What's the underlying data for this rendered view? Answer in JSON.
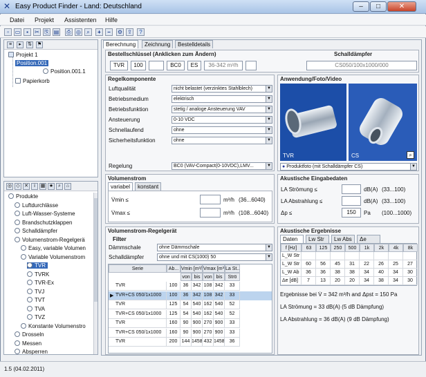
{
  "window": {
    "title": "Easy Product Finder - Land: Deutschland",
    "minimize": "–",
    "maximize": "□",
    "close": "✕"
  },
  "menu": [
    "Datei",
    "Projekt",
    "Assistenten",
    "Hilfe"
  ],
  "project_tree": {
    "items": [
      "Projekt 1",
      "Position.001",
      "Position.001.1",
      "Papierkorb"
    ]
  },
  "product_tree": {
    "items": [
      "Produkte",
      "Luftdurchlässe",
      "Luft-Wasser-Systeme",
      "Brandschutzklappen",
      "Schalldämpfer",
      "Volumenstrom-Regelgerä",
      "Easy, variable Volumen",
      "Variable Volumenstrom",
      "TVR",
      "TVRK",
      "TVR-Ex",
      "TVJ",
      "TVT",
      "TVA",
      "TVZ",
      "Konstante Volumenstro",
      "Drosseln",
      "Messen",
      "Absperren"
    ]
  },
  "tabs": [
    "Berechnung",
    "Zeichnung",
    "Bestelldetails"
  ],
  "order_key": {
    "title": "Bestellschlüssel (Anklicken zum Ändern)",
    "parts": [
      "TVR",
      "100",
      "",
      "BC0",
      "ES",
      "36-342 m³/h",
      ""
    ],
    "silencer_title": "Schalldämpfer",
    "silencer_value": "CS050/100x1000/000"
  },
  "components": {
    "title": "Regelkomponente",
    "rows": [
      {
        "label": "Luftqualität",
        "value": "nicht belastet (verzinktes Stahlblech)"
      },
      {
        "label": "Betriebsmedium",
        "value": "elektrisch"
      },
      {
        "label": "Betriebsfunktion",
        "value": "stetig / analoge Ansteuerung VAV"
      },
      {
        "label": "Ansteuerung",
        "value": "0-10 VDC"
      },
      {
        "label": "Schnellaufend",
        "value": "ohne"
      },
      {
        "label": "Sicherheitsfunktion",
        "value": "ohne"
      }
    ],
    "regelung_label": "Regelung",
    "regelung_value": "BC0 (VAV-Compact(0-10VDC),LMV..."
  },
  "photo": {
    "title": "Anwendung/Foto/Video",
    "labels": [
      "TVR",
      "CS"
    ],
    "select": "Produktfoto (mit Schalldämpfer CS)"
  },
  "volume": {
    "title": "Volumenstrom",
    "tabs": [
      "variabel",
      "konstant"
    ],
    "rows": [
      {
        "label": "V̇min ≤",
        "value": "",
        "unit": "m³/h",
        "range": "(36...6040)"
      },
      {
        "label": "V̇max ≤",
        "value": "",
        "unit": "m³/h",
        "range": "(108...6040)"
      }
    ]
  },
  "acoustic_in": {
    "title": "Akustische Eingabedaten",
    "rows": [
      {
        "label": "LA Strömung ≤",
        "value": "",
        "unit": "dB(A)",
        "range": "(33...100)"
      },
      {
        "label": "LA Abstrahlung ≤",
        "value": "",
        "unit": "dB(A)",
        "range": "(33...100)"
      },
      {
        "label": "Δp ≤",
        "value": "150",
        "unit": "Pa",
        "range": "(100...1000)"
      }
    ]
  },
  "filter": {
    "title": "Volumenstrom-Regelgerät",
    "sub": "Filter",
    "rows": [
      {
        "label": "Dämmschale",
        "value": "ohne Dämmschale"
      },
      {
        "label": "Schalldämpfer",
        "value": "ohne und mit CS(1000) 50"
      }
    ]
  },
  "table": {
    "headers": [
      "Serie",
      "Ab...",
      "Vmin [m³/h]",
      "Vmax [m³/h]",
      "La St..."
    ],
    "subheaders": [
      "",
      "",
      "von",
      "bis",
      "von",
      "bis",
      "Strö"
    ],
    "rows": [
      [
        "TVR",
        "100",
        "36",
        "342",
        "108",
        "342",
        "33"
      ],
      [
        "TVR+CS 050/1x1000",
        "100",
        "36",
        "342",
        "108",
        "342",
        "33"
      ],
      [
        "TVR",
        "125",
        "54",
        "540",
        "162",
        "540",
        "52"
      ],
      [
        "TVR+CS 050/1x1000",
        "125",
        "54",
        "540",
        "162",
        "540",
        "52"
      ],
      [
        "TVR",
        "160",
        "90",
        "900",
        "270",
        "900",
        "33"
      ],
      [
        "TVR+CS 050/1x1000",
        "160",
        "90",
        "900",
        "270",
        "900",
        "33"
      ],
      [
        "TVR",
        "200",
        "144",
        "1458",
        "432",
        "1458",
        "36"
      ]
    ]
  },
  "results": {
    "title": "Akustische Ergebnisse",
    "tabs": [
      "Daten",
      "Lw Str",
      "Lw Abs",
      "Δe"
    ],
    "headers": [
      "f [Hz]",
      "63",
      "125",
      "250",
      "500",
      "1k",
      "2k",
      "4k",
      "8k"
    ],
    "rows": [
      [
        "L_W Str",
        "",
        "",
        "",
        "",
        "",
        "",
        "",
        ""
      ],
      [
        "L_W Str",
        "60",
        "56",
        "45",
        "31",
        "22",
        "26",
        "25",
        "27"
      ],
      [
        "L_W Ab",
        "36",
        "36",
        "38",
        "38",
        "34",
        "40",
        "34",
        "30"
      ],
      [
        "Δe [dB]",
        "7",
        "13",
        "20",
        "20",
        "34",
        "38",
        "34",
        "30"
      ]
    ],
    "summary": "Ergebnisse bei V̇ = 342 m³/h and Δpst = 150 Pa",
    "line1": "LA Strömung = 33 dB(A) (5 dB Dämpfung)",
    "line2": "LA Abstrahlung = 36 dB(A) (9 dB Dämpfung)"
  },
  "status": {
    "text": "1.5 (04.02.2011)"
  }
}
